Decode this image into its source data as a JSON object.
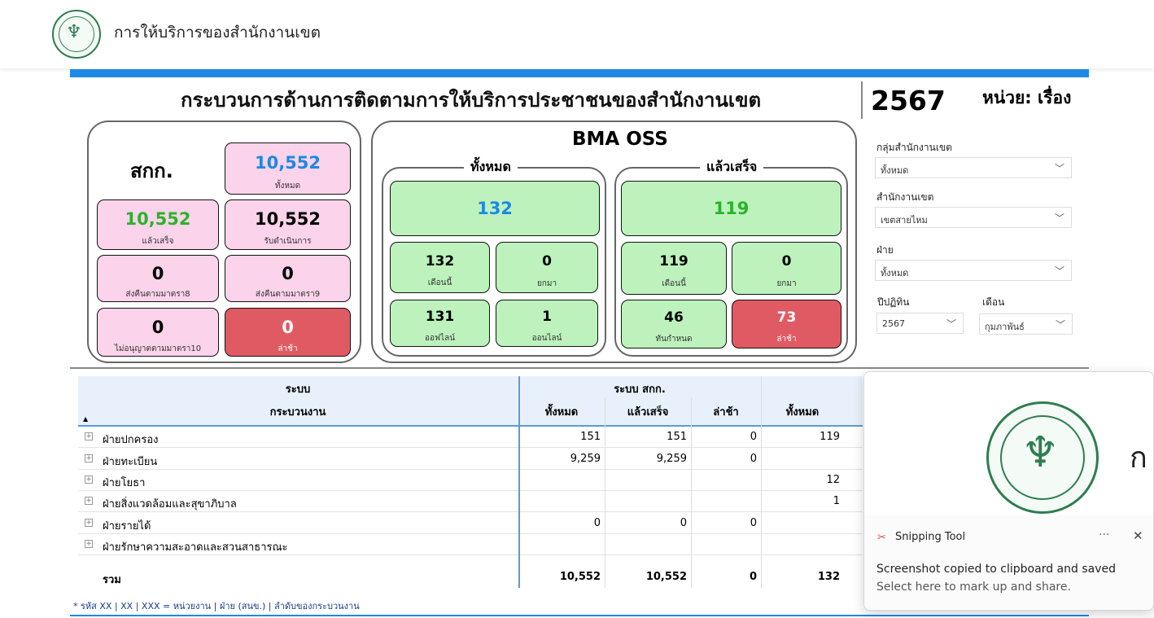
{
  "app": {
    "title": "การให้บริการของสำนักงานเขต",
    "logo_icon": "bma-seal-icon"
  },
  "report": {
    "title": "กระบวนการด้านการติดตามการให้บริการประชาชนของสำนักงานเขต",
    "year": "2567",
    "unit": "หน่วย: เรื่อง",
    "accent": "#1e88e5"
  },
  "skk": {
    "title": "สกก.",
    "total": {
      "value": "10,552",
      "label": "ทั้งหมด"
    },
    "done": {
      "value": "10,552",
      "label": "แล้วเสร็จ"
    },
    "in_progress": {
      "value": "10,552",
      "label": "รับดำเนินการ"
    },
    "ret8": {
      "value": "0",
      "label": "ส่งคืนตามมาตรา8"
    },
    "ret9": {
      "value": "0",
      "label": "ส่งคืนตามมาตรา9"
    },
    "deny10": {
      "value": "0",
      "label": "ไม่อนุญาตตามมาตรา10"
    },
    "late": {
      "value": "0",
      "label": "ล่าช้า"
    }
  },
  "oss": {
    "title": "BMA OSS",
    "all": {
      "title": "ทั้งหมด",
      "total": "132",
      "this_month": {
        "value": "132",
        "label": "เดือนนี้"
      },
      "carried": {
        "value": "0",
        "label": "ยกมา"
      },
      "offline": {
        "value": "131",
        "label": "ออฟไลน์"
      },
      "online": {
        "value": "1",
        "label": "ออนไลน์"
      }
    },
    "done": {
      "title": "แล้วเสร็จ",
      "total": "119",
      "this_month": {
        "value": "119",
        "label": "เดือนนี้"
      },
      "carried": {
        "value": "0",
        "label": "ยกมา"
      },
      "ontime": {
        "value": "46",
        "label": "ทันกำหนด"
      },
      "late": {
        "value": "73",
        "label": "ล่าช้า"
      }
    }
  },
  "slicers": {
    "group": {
      "label": "กลุ่มสำนักงานเขต",
      "value": "ทั้งหมด"
    },
    "district": {
      "label": "สำนักงานเขต",
      "value": "เขตสายไหม"
    },
    "division": {
      "label": "ฝ่าย",
      "value": "ทั้งหมด"
    },
    "fiscal_year": {
      "label": "ปีปฏิทิน",
      "value": "2567"
    },
    "month": {
      "label": "เดือน",
      "value": "กุมภาพันธ์"
    }
  },
  "table": {
    "header_top_left": "ระบบ",
    "header_top_group": "ระบบ สกก.",
    "header_process": "กระบวนงาน",
    "cols": [
      "ทั้งหมด",
      "แล้วเสร็จ",
      "ล่าช้า",
      "ทั้งหมด"
    ],
    "rows": [
      {
        "name": "ฝ่ายปกครอง",
        "c1": "151",
        "c2": "151",
        "c3": "0",
        "c4": "119"
      },
      {
        "name": "ฝ่ายทะเบียน",
        "c1": "9,259",
        "c2": "9,259",
        "c3": "0",
        "c4": ""
      },
      {
        "name": "ฝ่ายโยธา",
        "c1": "",
        "c2": "",
        "c3": "",
        "c4": "12"
      },
      {
        "name": "ฝ่ายสิ่งแวดล้อมและสุขาภิบาล",
        "c1": "",
        "c2": "",
        "c3": "",
        "c4": "1"
      },
      {
        "name": "ฝ่ายรายได้",
        "c1": "0",
        "c2": "0",
        "c3": "0",
        "c4": ""
      },
      {
        "name": "ฝ่ายรักษาความสะอาดและสวนสาธารณะ",
        "c1": "",
        "c2": "",
        "c3": "",
        "c4": ""
      }
    ],
    "total": {
      "label": "รวม",
      "c1": "10,552",
      "c2": "10,552",
      "c3": "0",
      "c4": "132"
    },
    "note": "* รหัส XX | XX | XXX = หน่วยงาน | ฝ่าย (สนข.) | ลำดับของกระบวนงาน"
  },
  "toast": {
    "app": "Snipping Tool",
    "message": "Screenshot copied to clipboard and saved",
    "sub": "Select here to mark up and share.",
    "preview_text": "ก"
  }
}
